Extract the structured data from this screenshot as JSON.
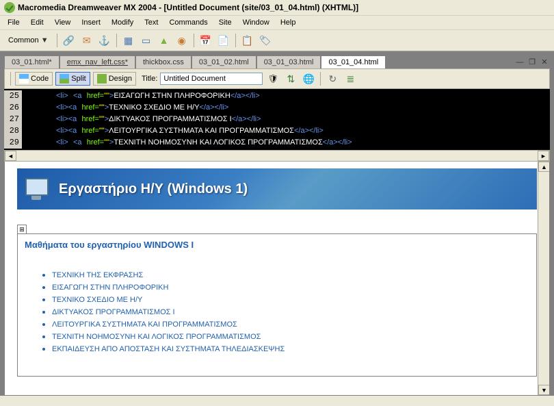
{
  "window": {
    "title": "Macromedia Dreamweaver MX 2004 - [Untitled Document (site/03_01_04.html) (XHTML)]"
  },
  "menu": {
    "file": "File",
    "edit": "Edit",
    "view": "View",
    "insert": "Insert",
    "modify": "Modify",
    "text": "Text",
    "commands": "Commands",
    "site": "Site",
    "window": "Window",
    "help": "Help"
  },
  "toolbar": {
    "common": "Common"
  },
  "tabs": {
    "t1": "03_01.html*",
    "t2": "emx_nav_left.css*",
    "t3": "thickbox.css",
    "t4": "03_01_02.html",
    "t5": "03_01_03.html",
    "t6": "03_01_04.html"
  },
  "viewbar": {
    "code": "Code",
    "split": "Split",
    "design": "Design",
    "title_label": "Title:",
    "title_value": "Untitled Document"
  },
  "code": {
    "lines": [
      {
        "n": "25",
        "pad": "<li> <a href=\"\">",
        "txt": "ΕΙΣΑΓΩΓΗ ΣΤΗΝ ΠΛΗΡΟΦΟΡΙΚΗ",
        "end": "</a></li>"
      },
      {
        "n": "26",
        "pad": "<li><a href=\"\">",
        "txt": "ΤΕΧΝΙΚΟ ΣΧΕΔΙΟ ΜΕ Η/Υ",
        "end": "</a></li>"
      },
      {
        "n": "27",
        "pad": "<li><a href=\"\">",
        "txt": "ΔΙΚΤΥΑΚΟΣ ΠΡΟΓΡΑΜΜΑΤΙΣΜΟΣ I",
        "end": "</a></li>"
      },
      {
        "n": "28",
        "pad": "<li><a href=\"\">",
        "txt": "ΛΕΙΤΟΥΡΓΙΚΑ ΣΥΣΤΗΜΑΤΑ ΚΑΙ ΠΡΟΓΡΑΜΜΑΤΙΣΜΟΣ",
        "end": "</a></li>"
      },
      {
        "n": "29",
        "pad": "<li> <a href=\"\">",
        "txt": "ΤΕΧΝΙΤΗ ΝΟΗΜΟΣΥΝΗ ΚΑΙ ΛΟΓΙΚΟΣ ΠΡΟΓΡΑΜΜΑΤΙΣΜΟΣ",
        "end": "</a></li>"
      }
    ]
  },
  "page": {
    "banner": "Εργαστήριο Η/Υ (Windows 1)",
    "section_title": "Μαθήματα του εργαστηρίου WINDOWS I",
    "links": [
      "ΤΕΧΝΙΚΗ ΤΗΣ ΕΚΦΡΑΣΗΣ",
      "ΕΙΣΑΓΩΓΗ ΣΤΗΝ ΠΛΗΡΟΦΟΡΙΚΗ",
      "ΤΕΧΝΙΚΟ ΣΧΕΔΙΟ ΜΕ Η/Υ",
      "ΔΙΚΤΥΑΚΟΣ ΠΡΟΓΡΑΜΜΑΤΙΣΜΟΣ I",
      "ΛΕΙΤΟΥΡΓΙΚΑ ΣΥΣΤΗΜΑΤΑ ΚΑΙ ΠΡΟΓΡΑΜΜΑΤΙΣΜΟΣ",
      "ΤΕΧΝΙΤΗ ΝΟΗΜΟΣΥΝΗ ΚΑΙ ΛΟΓΙΚΟΣ ΠΡΟΓΡΑΜΜΑΤΙΣΜΟΣ",
      "ΕΚΠΑΙΔΕΥΣΗ ΑΠΟ ΑΠΟΣΤΑΣΗ ΚΑΙ ΣΥΣΤΗΜΑΤΑ ΤΗΛΕΔΙΑΣΚΕΨΗΣ"
    ]
  }
}
